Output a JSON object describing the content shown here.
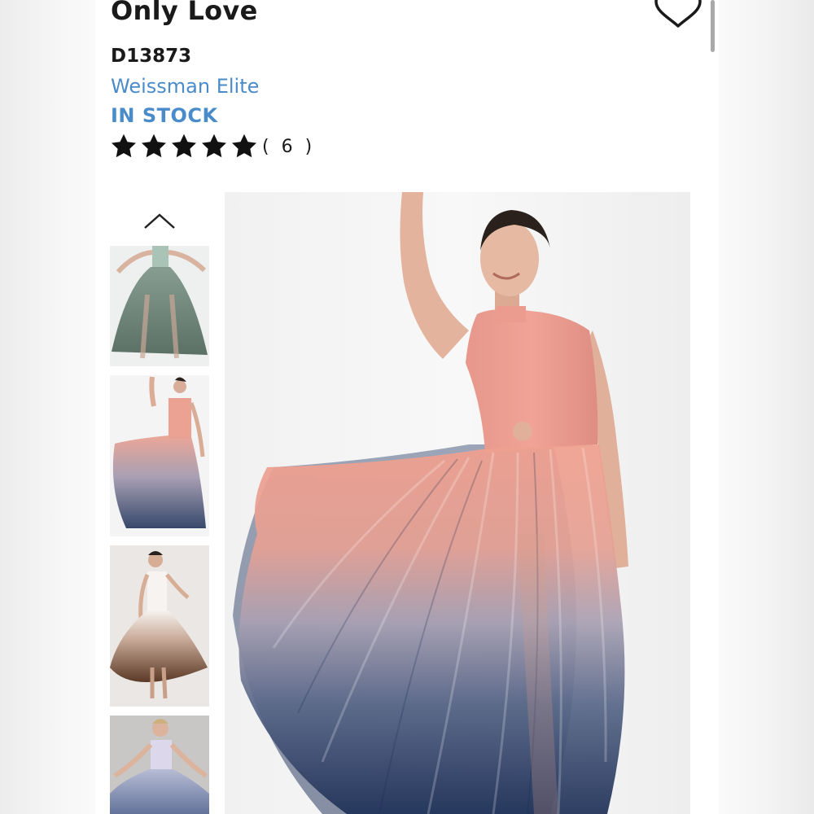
{
  "product": {
    "title": "Only Love",
    "sku": "D13873",
    "brand": "Weissman Elite",
    "stock_status": "IN STOCK",
    "rating": 5,
    "review_count": "( 6 )"
  },
  "icons": {
    "favorite": "heart-outline-icon",
    "gallery_up": "chevron-up-icon",
    "rating": "star-icon"
  },
  "colors": {
    "brand_link": "#4a8cc9",
    "stock": "#4a8cc9",
    "text": "#1a1a1a"
  },
  "gallery": {
    "thumbnails": [
      "sage-green",
      "coral-navy-ombre",
      "white-brown-ombre",
      "lavender-blue"
    ],
    "selected_index": 1
  }
}
